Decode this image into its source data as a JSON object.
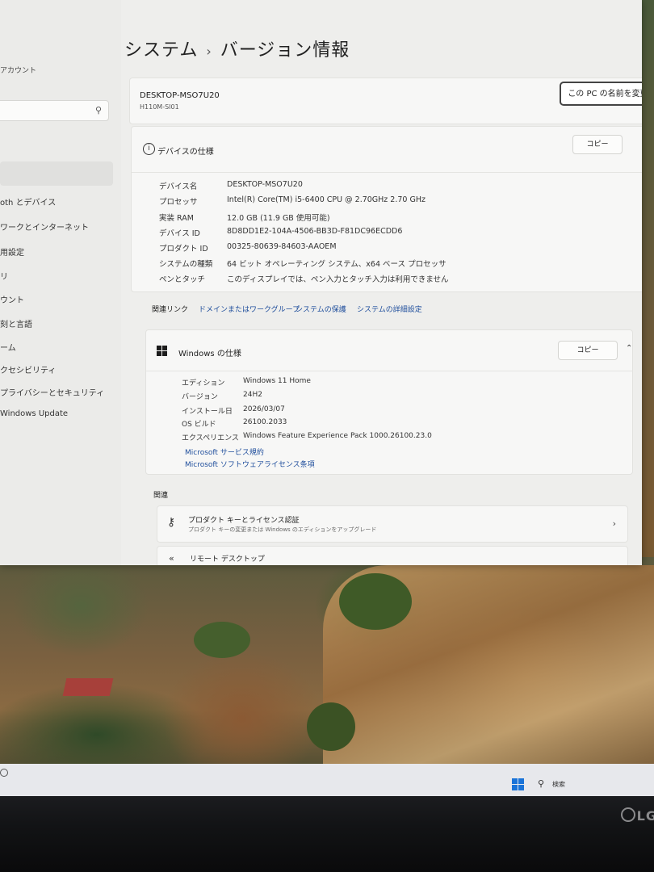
{
  "breadcrumb": {
    "parent": "システム",
    "separator": "›",
    "current": "バージョン情報"
  },
  "sidebar": {
    "account_label": "アカウント",
    "search_placeholder": "",
    "items": [
      {
        "label": "oth とデバイス"
      },
      {
        "label": "ワークとインターネット"
      },
      {
        "label": "用設定"
      },
      {
        "label": "リ"
      },
      {
        "label": "ウント"
      },
      {
        "label": "刻と言語"
      },
      {
        "label": "ーム"
      },
      {
        "label": "クセシビリティ"
      },
      {
        "label": "プライバシーとセキュリティ"
      },
      {
        "label": "Windows Update"
      }
    ]
  },
  "device": {
    "name": "DESKTOP-MSO7U20",
    "model": "H110M-SI01",
    "rename_button": "この PC の名前を変更"
  },
  "device_specs": {
    "title": "デバイスの仕様",
    "copy_button": "コピー",
    "rows": [
      {
        "label": "デバイス名",
        "value": "DESKTOP-MSO7U20"
      },
      {
        "label": "プロセッサ",
        "value": "Intel(R) Core(TM) i5-6400 CPU @ 2.70GHz   2.70 GHz"
      },
      {
        "label": "実装 RAM",
        "value": "12.0 GB (11.9 GB 使用可能)"
      },
      {
        "label": "デバイス ID",
        "value": "8D8DD1E2-104A-4506-BB3D-F81DC96ECDD6"
      },
      {
        "label": "プロダクト ID",
        "value": "00325-80639-84603-AAOEM"
      },
      {
        "label": "システムの種類",
        "value": "64 ビット オペレーティング システム、x64 ベース プロセッサ"
      },
      {
        "label": "ペンとタッチ",
        "value": "このディスプレイでは、ペン入力とタッチ入力は利用できません"
      }
    ]
  },
  "related_links": {
    "label": "関連リンク",
    "links": [
      "ドメインまたはワークグループ",
      "システムの保護",
      "システムの詳細設定"
    ]
  },
  "windows_specs": {
    "title": "Windows の仕様",
    "copy_button": "コピー",
    "rows": [
      {
        "label": "エディション",
        "value": "Windows 11 Home"
      },
      {
        "label": "バージョン",
        "value": "24H2"
      },
      {
        "label": "インストール日",
        "value": "2026/03/07"
      },
      {
        "label": "OS ビルド",
        "value": "26100.2033"
      },
      {
        "label": "エクスペリエンス",
        "value": "Windows Feature Experience Pack 1000.26100.23.0"
      }
    ],
    "links": [
      "Microsoft サービス規約",
      "Microsoft ソフトウェアライセンス条項"
    ]
  },
  "related": {
    "heading": "関連",
    "product_key": {
      "title": "プロダクト キーとライセンス認証",
      "description": "プロダクト キーの変更または Windows のエディションをアップグレード"
    },
    "remote_desktop": {
      "title": "リモート デスクトップ"
    }
  },
  "taskbar": {
    "search_label": "検索"
  },
  "monitor": {
    "brand": "LG"
  }
}
